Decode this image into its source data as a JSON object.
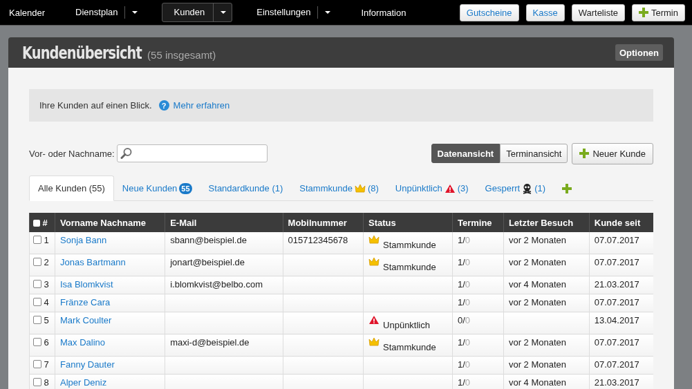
{
  "nav": {
    "items": [
      {
        "label": "Kalender",
        "dropdown": false,
        "selected": false
      },
      {
        "label": "Dienstplan",
        "dropdown": true,
        "selected": false
      },
      {
        "label": "Kunden",
        "dropdown": true,
        "selected": true
      },
      {
        "label": "Einstellungen",
        "dropdown": true,
        "selected": false
      },
      {
        "label": "Information",
        "dropdown": false,
        "selected": false
      }
    ],
    "buttons": [
      {
        "label": "Gutscheine",
        "kind": "link"
      },
      {
        "label": "Kasse",
        "kind": "link"
      },
      {
        "label": "Warteliste",
        "kind": "plain"
      },
      {
        "label": "Termin",
        "kind": "add"
      }
    ]
  },
  "header": {
    "title": "Kundenübersicht",
    "subtitle": "(55 insgesamt)",
    "options": "Optionen"
  },
  "info": {
    "text": "Ihre Kunden auf einen Blick.",
    "help": "?",
    "link": "Mehr erfahren"
  },
  "search": {
    "label": "Vor- oder Nachname:"
  },
  "views": [
    {
      "label": "Datenansicht",
      "selected": true
    },
    {
      "label": "Terminansicht",
      "selected": false
    }
  ],
  "new_customer": "Neuer Kunde",
  "tabs": [
    {
      "label": "Alle Kunden (55)",
      "selected": true
    },
    {
      "label": "Neue Kunden",
      "badge": "55",
      "selected": false
    },
    {
      "label": "Standardkunde (1)",
      "selected": false
    },
    {
      "label": "Stammkunde",
      "kind": "crown",
      "count": "(8)",
      "selected": false
    },
    {
      "label": "Unpünktlich",
      "kind": "warning",
      "count": "(3)",
      "selected": false
    },
    {
      "label": "Gesperrt",
      "kind": "skull",
      "count": "(1)",
      "selected": false
    }
  ],
  "table": {
    "select_all_checked": false,
    "columns": [
      "#",
      "Vorname Nachname",
      "E-Mail",
      "Mobilnummer",
      "Status",
      "Termine",
      "Letzter Besuch",
      "Kunde seit"
    ],
    "rows": [
      {
        "checked": false,
        "num": "1",
        "name": "Sonja Bann",
        "email": "sbann@beispiel.de",
        "mobile": "015712345678",
        "status": {
          "kind": "crown",
          "label": "Stammkunde"
        },
        "termine": "1/",
        "termine_open": "0",
        "last_visit": "vor 2 Monaten",
        "since": "07.07.2017"
      },
      {
        "checked": false,
        "num": "2",
        "name": "Jonas Bartmann",
        "email": "jonart@beispiel.de",
        "status": {
          "kind": "crown",
          "label": "Stammkunde"
        },
        "termine": "1/",
        "termine_open": "0",
        "last_visit": "vor 2 Monaten",
        "since": "07.07.2017"
      },
      {
        "checked": false,
        "num": "3",
        "name": "Isa Blomkvist",
        "email": "i.blomkvist@belbo.com",
        "termine": "1/",
        "termine_open": "0",
        "last_visit": "vor 4 Monaten",
        "since": "21.03.2017"
      },
      {
        "checked": false,
        "num": "4",
        "name": "Fränze Cara",
        "termine": "1/",
        "termine_open": "0",
        "last_visit": "vor 2 Monaten",
        "since": "07.07.2017"
      },
      {
        "checked": false,
        "num": "5",
        "name": "Mark Coulter",
        "status": {
          "kind": "warning",
          "label": "Unpünktlich"
        },
        "termine": "0/",
        "termine_open": "0",
        "since": "13.04.2017"
      },
      {
        "checked": false,
        "num": "6",
        "name": "Max Dalino",
        "email": "maxi-d@beispiel.de",
        "status": {
          "kind": "crown",
          "label": "Stammkunde"
        },
        "termine": "1/",
        "termine_open": "0",
        "last_visit": "vor 2 Monaten",
        "since": "07.07.2017"
      },
      {
        "checked": false,
        "num": "7",
        "name": "Fanny Dauter",
        "termine": "1/",
        "termine_open": "0",
        "last_visit": "vor 2 Monaten",
        "since": "07.07.2017"
      },
      {
        "checked": false,
        "num": "8",
        "name": "Alper Deniz",
        "termine": "1/",
        "termine_open": "0",
        "last_visit": "vor 4 Monaten",
        "since": "21.03.2017"
      }
    ]
  }
}
